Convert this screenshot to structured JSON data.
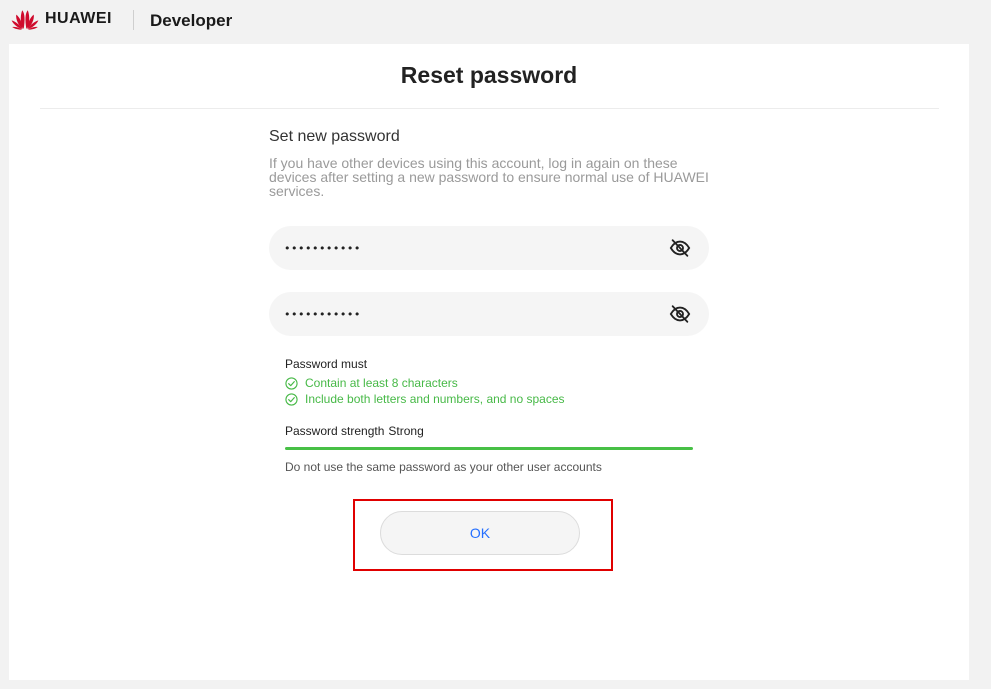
{
  "header": {
    "brand": "HUAWEI",
    "site": "Developer",
    "logo_icon": "huawei-flower-logo",
    "logo_color": "#cf0a2c"
  },
  "page": {
    "title": "Reset password",
    "subtitle": "Set new password",
    "description": "If you have other devices using this account, log in again on these devices after setting a new password to ensure normal use of HUAWEI services."
  },
  "form": {
    "password": {
      "value": "•••••••••••",
      "icon": "eye-hidden-icon"
    },
    "confirm_password": {
      "value": "•••••••••••",
      "icon": "eye-hidden-icon"
    }
  },
  "rules": {
    "heading": "Password must",
    "items": [
      {
        "text": "Contain at least 8 characters",
        "icon": "check-circle-icon"
      },
      {
        "text": "Include both letters and numbers, and no spaces",
        "icon": "check-circle-icon"
      }
    ],
    "color": "#47b947"
  },
  "strength": {
    "label": "Password strength",
    "value": "Strong",
    "level": 1.0,
    "color": "#47c046"
  },
  "note": "Do not use the same password as your other user accounts",
  "actions": {
    "ok_label": "OK",
    "ok_color": "#256fff",
    "highlight_color": "#e00000"
  }
}
